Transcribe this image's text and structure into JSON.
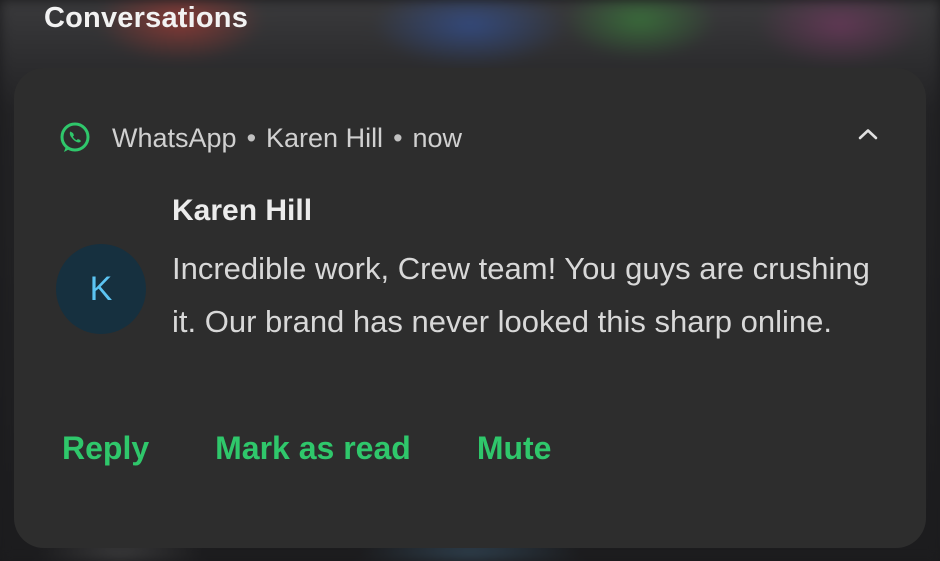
{
  "section": {
    "title": "Conversations"
  },
  "notification": {
    "app_icon": "whatsapp-icon",
    "app_name": "WhatsApp",
    "separator": "•",
    "conversation": "Karen Hill",
    "time": "now",
    "expand_icon": "chevron-up-icon",
    "avatar_initial": "K",
    "sender": "Karen Hill",
    "message": "Incredible work, Crew team! You guys are crushing it. Our brand has never looked this sharp online.",
    "actions": {
      "reply": "Reply",
      "mark_as_read": "Mark as read",
      "mute": "Mute"
    }
  },
  "colors": {
    "accent": "#2fc76b",
    "card_background": "#2d2d2d",
    "avatar_background": "#16303f",
    "avatar_text": "#5cc4f2"
  }
}
